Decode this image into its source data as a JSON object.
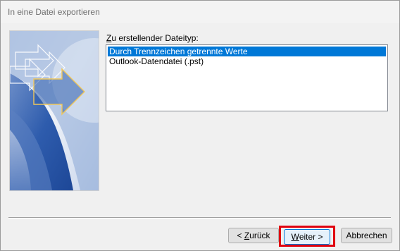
{
  "window": {
    "title": "In eine Datei exportieren"
  },
  "content": {
    "label_accesskey": "Z",
    "label_rest": "u erstellender Dateityp:",
    "items": [
      {
        "label": "Durch Trennzeichen getrennte Werte",
        "selected": true
      },
      {
        "label": "Outlook-Datendatei (.pst)",
        "selected": false
      }
    ]
  },
  "buttons": {
    "back_prefix": "< ",
    "back_accesskey": "Z",
    "back_rest": "urück",
    "next_accesskey": "W",
    "next_rest": "eiter >",
    "cancel": "Abbrechen"
  },
  "colors": {
    "selection": "#0078d7",
    "highlight_border": "#e0000f",
    "banner_blue": "#2e5cad"
  }
}
